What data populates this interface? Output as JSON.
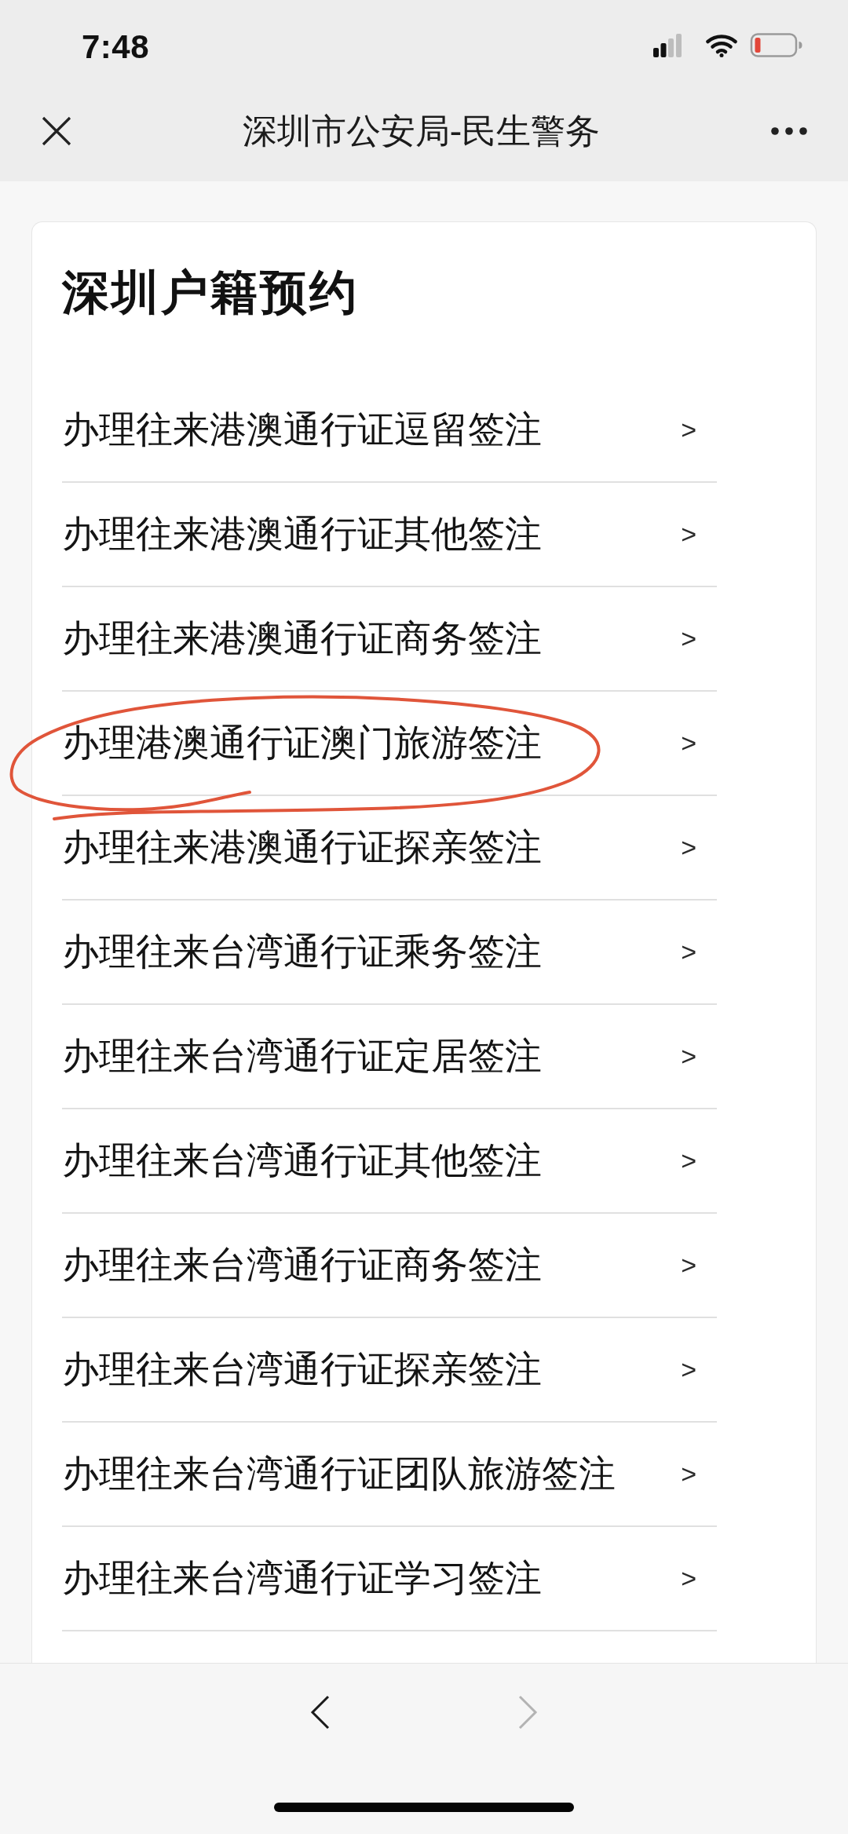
{
  "status_bar": {
    "time": "7:48"
  },
  "nav_bar": {
    "title": "深圳市公安局-民生警务"
  },
  "card": {
    "title": "深圳户籍预约",
    "items": [
      {
        "label": "办理往来港澳通行证逗留签注",
        "chevron": ">",
        "circled": false
      },
      {
        "label": "办理往来港澳通行证其他签注",
        "chevron": ">",
        "circled": false
      },
      {
        "label": "办理往来港澳通行证商务签注",
        "chevron": ">",
        "circled": false
      },
      {
        "label": "办理港澳通行证澳门旅游签注",
        "chevron": ">",
        "circled": true
      },
      {
        "label": "办理往来港澳通行证探亲签注",
        "chevron": ">",
        "circled": false
      },
      {
        "label": "办理往来台湾通行证乘务签注",
        "chevron": ">",
        "circled": false
      },
      {
        "label": "办理往来台湾通行证定居签注",
        "chevron": ">",
        "circled": false
      },
      {
        "label": "办理往来台湾通行证其他签注",
        "chevron": ">",
        "circled": false
      },
      {
        "label": "办理往来台湾通行证商务签注",
        "chevron": ">",
        "circled": false
      },
      {
        "label": "办理往来台湾通行证探亲签注",
        "chevron": ">",
        "circled": false
      },
      {
        "label": "办理往来台湾通行证团队旅游签注",
        "chevron": ">",
        "circled": false
      },
      {
        "label": "办理往来台湾通行证学习签注",
        "chevron": ">",
        "circled": false
      }
    ]
  },
  "bottom_bar": {
    "back": {
      "disabled": false
    },
    "forward": {
      "disabled": true
    }
  }
}
